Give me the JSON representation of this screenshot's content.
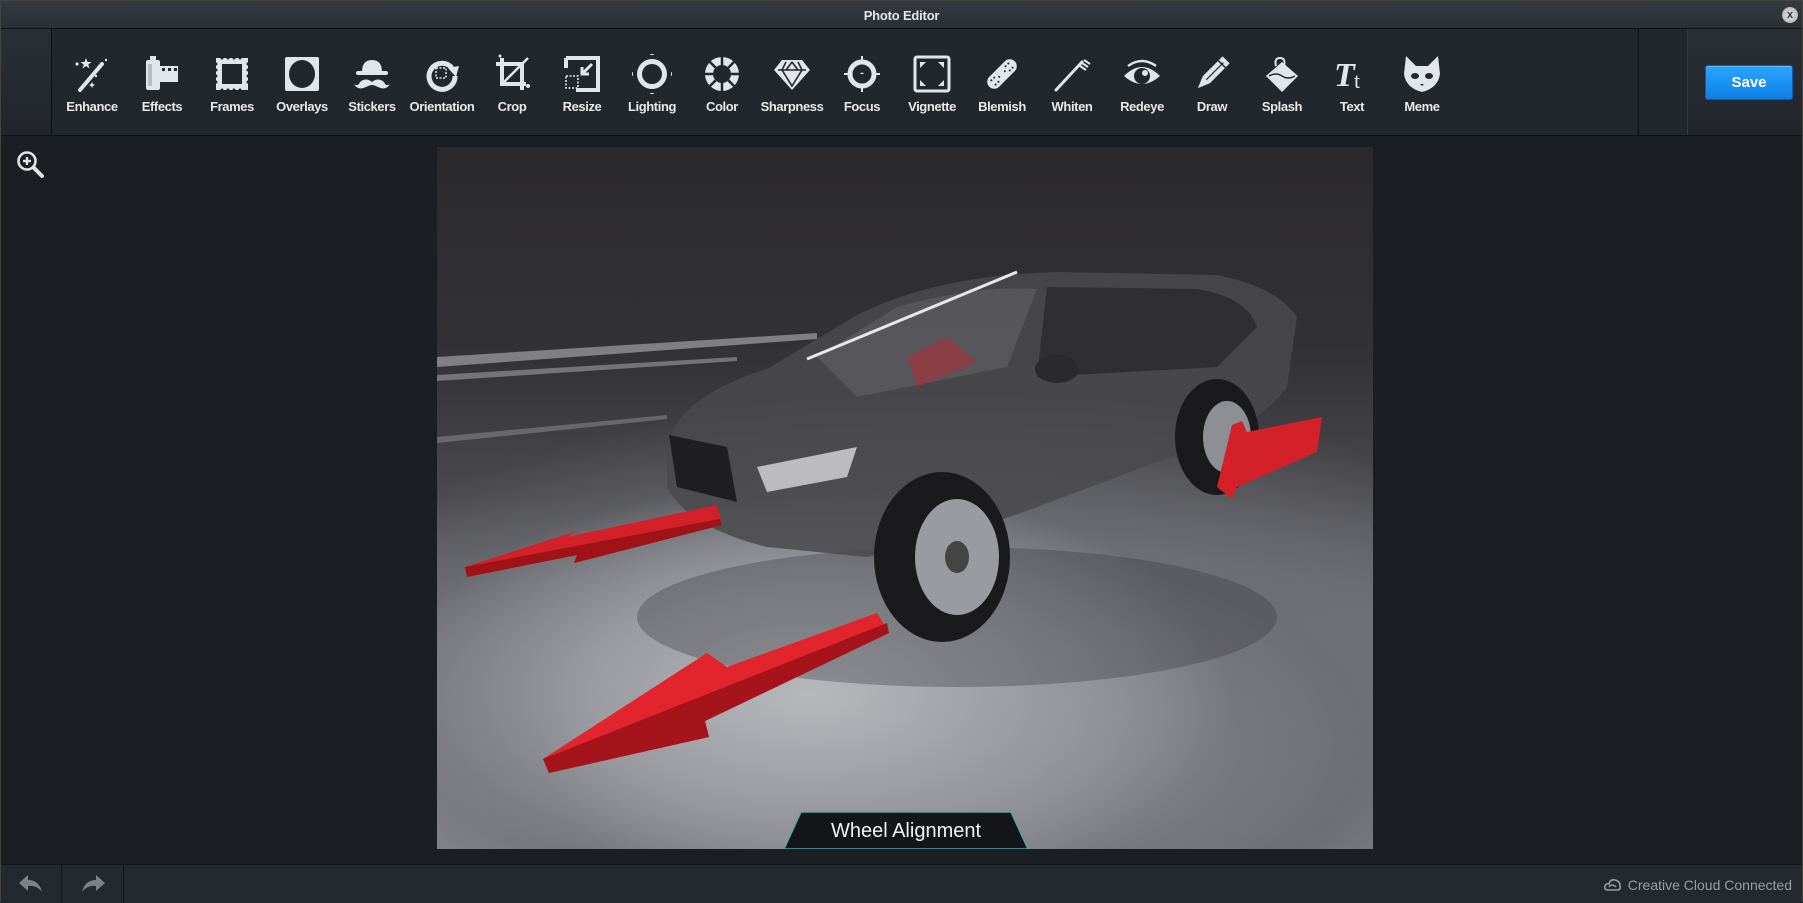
{
  "window": {
    "title": "Photo Editor",
    "close_label": "x"
  },
  "toolbar": {
    "tools": [
      {
        "id": "enhance",
        "label": "Enhance",
        "icon": "magic-wand-icon"
      },
      {
        "id": "effects",
        "label": "Effects",
        "icon": "film-canister-icon"
      },
      {
        "id": "frames",
        "label": "Frames",
        "icon": "frame-icon"
      },
      {
        "id": "overlays",
        "label": "Overlays",
        "icon": "overlay-icon"
      },
      {
        "id": "stickers",
        "label": "Stickers",
        "icon": "hat-mustache-icon"
      },
      {
        "id": "orientation",
        "label": "Orientation",
        "icon": "rotate-icon"
      },
      {
        "id": "crop",
        "label": "Crop",
        "icon": "crop-icon"
      },
      {
        "id": "resize",
        "label": "Resize",
        "icon": "resize-icon"
      },
      {
        "id": "lighting",
        "label": "Lighting",
        "icon": "sun-icon"
      },
      {
        "id": "color",
        "label": "Color",
        "icon": "color-wheel-icon"
      },
      {
        "id": "sharpness",
        "label": "Sharpness",
        "icon": "diamond-icon"
      },
      {
        "id": "focus",
        "label": "Focus",
        "icon": "crosshair-icon"
      },
      {
        "id": "vignette",
        "label": "Vignette",
        "icon": "vignette-icon"
      },
      {
        "id": "blemish",
        "label": "Blemish",
        "icon": "bandage-icon"
      },
      {
        "id": "whiten",
        "label": "Whiten",
        "icon": "toothbrush-icon"
      },
      {
        "id": "redeye",
        "label": "Redeye",
        "icon": "eye-icon"
      },
      {
        "id": "draw",
        "label": "Draw",
        "icon": "pencil-icon"
      },
      {
        "id": "splash",
        "label": "Splash",
        "icon": "paint-bucket-icon"
      },
      {
        "id": "text",
        "label": "Text",
        "icon": "text-icon"
      },
      {
        "id": "meme",
        "label": "Meme",
        "icon": "cat-mask-icon"
      }
    ],
    "save_label": "Save",
    "save_color": "#1a90f5"
  },
  "canvas": {
    "image_caption": "Wheel Alignment",
    "image_subject": "Car with red arrows indicating wheel alignment",
    "zoom_tool": "zoom-in-icon"
  },
  "statusbar": {
    "undo": "undo-icon",
    "redo": "redo-icon",
    "cloud_status": "Creative Cloud Connected"
  }
}
